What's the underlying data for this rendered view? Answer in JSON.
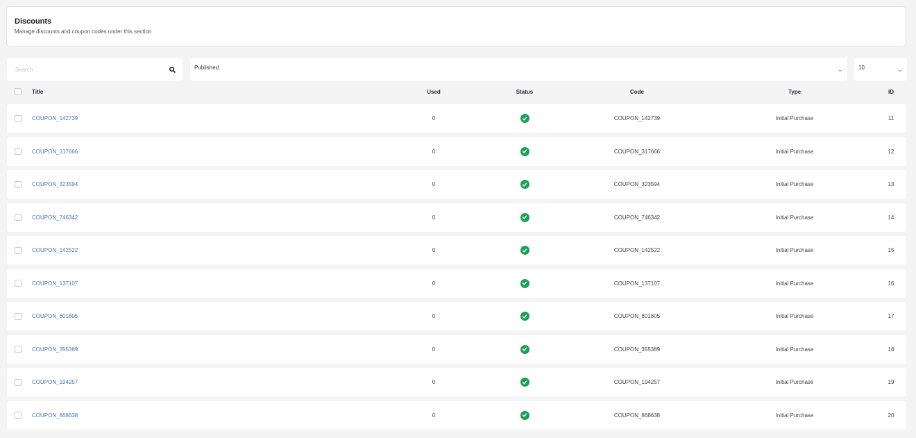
{
  "header": {
    "title": "Discounts",
    "subtitle": "Manage discounts and coupon codes under this section"
  },
  "filters": {
    "search_placeholder": "Search",
    "search_icon": "search-icon",
    "status_value": "Published",
    "per_page_value": "10",
    "dropdown_icon": "chevron-down-icon"
  },
  "table": {
    "columns": {
      "title": "Title",
      "used": "Used",
      "status": "Status",
      "code": "Code",
      "type": "Type",
      "id": "ID"
    },
    "status_color": "#1e9e5a",
    "link_color": "#4a79a8",
    "rows": [
      {
        "title": "COUPON_142739",
        "used": "0",
        "status": "check-circle-icon",
        "code": "COUPON_142739",
        "type": "Initial Purchase",
        "id": "11"
      },
      {
        "title": "COUPON_317666",
        "used": "0",
        "status": "check-circle-icon",
        "code": "COUPON_317666",
        "type": "Initial Purchase",
        "id": "12"
      },
      {
        "title": "COUPON_323594",
        "used": "0",
        "status": "check-circle-icon",
        "code": "COUPON_323594",
        "type": "Initial Purchase",
        "id": "13"
      },
      {
        "title": "COUPON_746342",
        "used": "0",
        "status": "check-circle-icon",
        "code": "COUPON_746342",
        "type": "Initial Purchase",
        "id": "14"
      },
      {
        "title": "COUPON_142522",
        "used": "0",
        "status": "check-circle-icon",
        "code": "COUPON_142522",
        "type": "Initial Purchase",
        "id": "15"
      },
      {
        "title": "COUPON_137107",
        "used": "0",
        "status": "check-circle-icon",
        "code": "COUPON_137107",
        "type": "Initial Purchase",
        "id": "16"
      },
      {
        "title": "COUPON_801805",
        "used": "0",
        "status": "check-circle-icon",
        "code": "COUPON_801805",
        "type": "Initial Purchase",
        "id": "17"
      },
      {
        "title": "COUPON_355389",
        "used": "0",
        "status": "check-circle-icon",
        "code": "COUPON_355389",
        "type": "Initial Purchase",
        "id": "18"
      },
      {
        "title": "COUPON_194257",
        "used": "0",
        "status": "check-circle-icon",
        "code": "COUPON_194257",
        "type": "Initial Purchase",
        "id": "19"
      },
      {
        "title": "COUPON_868638",
        "used": "0",
        "status": "check-circle-icon",
        "code": "COUPON_868638",
        "type": "Initial Purchase",
        "id": "20"
      }
    ]
  }
}
